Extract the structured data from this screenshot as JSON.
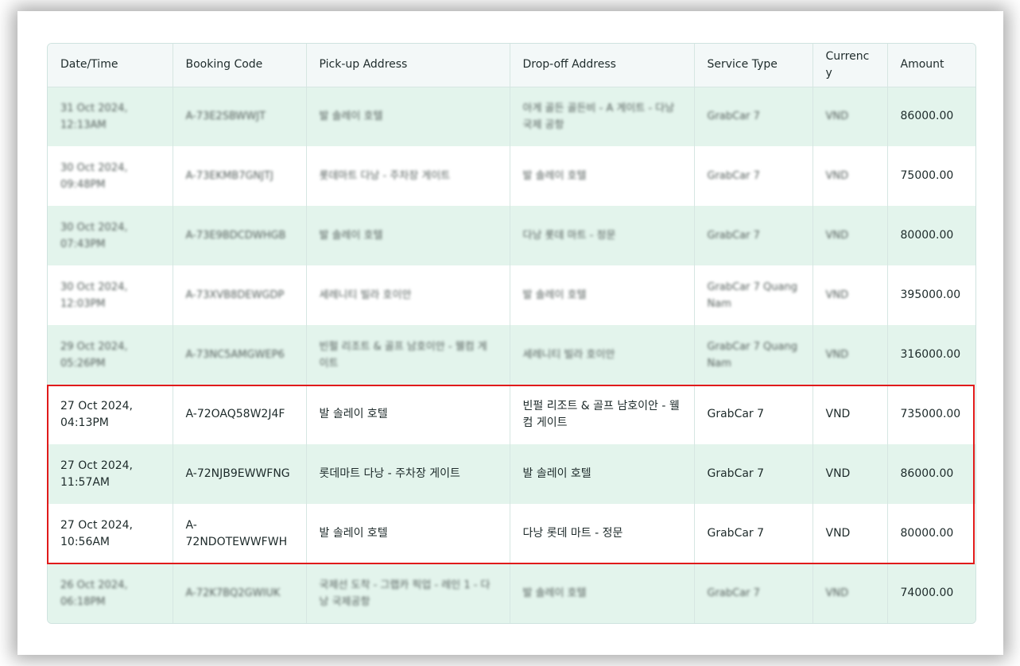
{
  "table": {
    "columns": [
      "Date/Time",
      "Booking Code",
      "Pick-up Address",
      "Drop-off Address",
      "Service Type",
      "Currency",
      "Amount"
    ],
    "rows": [
      {
        "datetime": "31 Oct 2024, 12:13AM",
        "code": "A-73E2SBWWJT",
        "pickup": "발 솔레이 호텔",
        "dropoff": "아게 골든 골든비 - A 게이트 - 다낭 국제 공항",
        "service": "GrabCar 7",
        "currency": "VND",
        "amount": "86000.00",
        "blurred": true
      },
      {
        "datetime": "30 Oct 2024, 09:48PM",
        "code": "A-73EKMB7GNJTJ",
        "pickup": "롯데마트 다낭 - 주차장 게이트",
        "dropoff": "발 솔레이 호텔",
        "service": "GrabCar 7",
        "currency": "VND",
        "amount": "75000.00",
        "blurred": true
      },
      {
        "datetime": "30 Oct 2024, 07:43PM",
        "code": "A-73E9BDCDWHGB",
        "pickup": "발 솔레이 호텔",
        "dropoff": "다낭 롯데 마트 - 정문",
        "service": "GrabCar 7",
        "currency": "VND",
        "amount": "80000.00",
        "blurred": true
      },
      {
        "datetime": "30 Oct 2024, 12:03PM",
        "code": "A-73XVB8DEWGDP",
        "pickup": "세레니티 빌라 호이안",
        "dropoff": "발 솔레이 호텔",
        "service": "GrabCar 7 Quang Nam",
        "currency": "VND",
        "amount": "395000.00",
        "blurred": true
      },
      {
        "datetime": "29 Oct 2024, 05:26PM",
        "code": "A-73NC5AMGWEP6",
        "pickup": "빈펄 리조트 & 골프 남호이안 - 웰컴 게이트",
        "dropoff": "세레니티 빌라 호이안",
        "service": "GrabCar 7 Quang Nam",
        "currency": "VND",
        "amount": "316000.00",
        "blurred": true
      },
      {
        "datetime": "27 Oct 2024, 04:13PM",
        "code": "A-72OAQ58W2J4F",
        "pickup": "발 솔레이 호텔",
        "dropoff": "빈펄 리조트 & 골프 남호이안 - 웰컴 게이트",
        "service": "GrabCar 7",
        "currency": "VND",
        "amount": "735000.00",
        "blurred": false
      },
      {
        "datetime": "27 Oct 2024, 11:57AM",
        "code": "A-72NJB9EWWFNG",
        "pickup": "롯데마트 다낭 - 주차장 게이트",
        "dropoff": "발 솔레이 호텔",
        "service": "GrabCar 7",
        "currency": "VND",
        "amount": "86000.00",
        "blurred": false
      },
      {
        "datetime": "27 Oct 2024, 10:56AM",
        "code": "A-72NDOTEWWFWH",
        "pickup": "발 솔레이 호텔",
        "dropoff": "다낭 롯데 마트 - 정문",
        "service": "GrabCar 7",
        "currency": "VND",
        "amount": "80000.00",
        "blurred": false
      },
      {
        "datetime": "26 Oct 2024, 06:18PM",
        "code": "A-72K7BQ2GWIUK",
        "pickup": "국제선 도착 - 그랩카 픽업 - 레인 1 - 다낭 국제공항",
        "dropoff": "발 솔레이 호텔",
        "service": "GrabCar 7",
        "currency": "VND",
        "amount": "74000.00",
        "blurred": true
      }
    ]
  },
  "colors": {
    "header_bg": "#f3f8f8",
    "row_tint": "#e3f4ec",
    "highlight_border": "#e01b1b"
  }
}
